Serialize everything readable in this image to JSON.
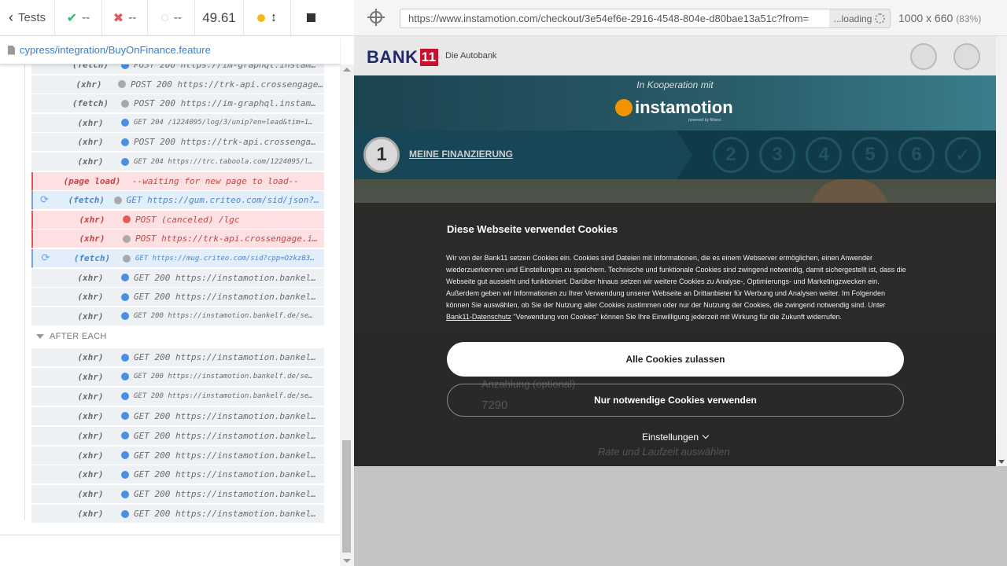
{
  "reporter": {
    "tests_label": "Tests",
    "passed": "--",
    "failed": "--",
    "pending": "--",
    "duration": "49.61",
    "spec_path": "cypress/integration/BuyOnFinance.feature",
    "hook_label": "AFTER EACH",
    "commands": [
      {
        "kind": "(fetch)",
        "dot": "blue",
        "text": "POST 200 https://im-graphql.instam…",
        "state": "normal",
        "small": false
      },
      {
        "kind": "(xhr)",
        "dot": "grey",
        "text": "POST 200 https://trk-api.crossengage.i…",
        "state": "normal",
        "small": false
      },
      {
        "kind": "(fetch)",
        "dot": "grey",
        "text": "POST 200 https://im-graphql.instam…",
        "state": "normal",
        "small": false
      },
      {
        "kind": "(xhr)",
        "dot": "blue",
        "text": "GET 204 /1224095/log/3/unip?en=lead&tim=1…",
        "state": "normal",
        "small": true
      },
      {
        "kind": "(xhr)",
        "dot": "blue",
        "text": "POST 200 https://trk-api.crossenga…",
        "state": "normal",
        "small": false
      },
      {
        "kind": "(xhr)",
        "dot": "blue",
        "text": "GET 204 https://trc.taboola.com/1224095/l…",
        "state": "normal",
        "small": true
      },
      {
        "kind": "(page load)",
        "dot": "",
        "text": "--waiting for new page to load--",
        "state": "failed",
        "small": false
      },
      {
        "kind": "(fetch)",
        "dot": "grey",
        "text": "GET https://gum.criteo.com/sid/json?origi…",
        "state": "pending",
        "small": false
      },
      {
        "kind": "(xhr)",
        "dot": "red",
        "text": "POST (canceled) /lgc",
        "state": "failed",
        "small": false
      },
      {
        "kind": "(xhr)",
        "dot": "grey",
        "text": "POST https://trk-api.crossengage.i…",
        "state": "failed",
        "small": false
      },
      {
        "kind": "(fetch)",
        "dot": "grey",
        "text": "GET https://mug.criteo.com/sid?cpp=OzkzB3…",
        "state": "pending",
        "small": true
      },
      {
        "kind": "(xhr)",
        "dot": "blue",
        "text": "GET 200 https://instamotion.bankel…",
        "state": "normal",
        "small": false
      },
      {
        "kind": "(xhr)",
        "dot": "blue",
        "text": "GET 200 https://instamotion.bankel…",
        "state": "normal",
        "small": false
      },
      {
        "kind": "(xhr)",
        "dot": "blue",
        "text": "GET 200 https://instamotion.bankelf.de/se…",
        "state": "normal",
        "small": true
      }
    ],
    "after_each": [
      {
        "kind": "(xhr)",
        "dot": "blue",
        "text": "GET 200 https://instamotion.bankel…",
        "small": false
      },
      {
        "kind": "(xhr)",
        "dot": "blue",
        "text": "GET 200 https://instamotion.bankelf.de/se…",
        "small": true
      },
      {
        "kind": "(xhr)",
        "dot": "blue",
        "text": "GET 200 https://instamotion.bankelf.de/se…",
        "small": true
      },
      {
        "kind": "(xhr)",
        "dot": "blue",
        "text": "GET 200 https://instamotion.bankel…",
        "small": false
      },
      {
        "kind": "(xhr)",
        "dot": "blue",
        "text": "GET 200 https://instamotion.bankel…",
        "small": false
      },
      {
        "kind": "(xhr)",
        "dot": "blue",
        "text": "GET 200 https://instamotion.bankel…",
        "small": false
      },
      {
        "kind": "(xhr)",
        "dot": "blue",
        "text": "GET 200 https://instamotion.bankel…",
        "small": false
      },
      {
        "kind": "(xhr)",
        "dot": "blue",
        "text": "GET 200 https://instamotion.bankel…",
        "small": false
      },
      {
        "kind": "(xhr)",
        "dot": "blue",
        "text": "GET 200 https://instamotion.bankel…",
        "small": false
      }
    ]
  },
  "aut": {
    "url": "https://www.instamotion.com/checkout/3e54ef6e-2916-4548-804e-d80bae13a51c?from=",
    "loading_label": "...loading",
    "viewport": "1000 x 660",
    "scale": "(83%)"
  },
  "site": {
    "brand": "BANK",
    "brand_num": "11",
    "tagline": "Die Autobank",
    "koop_text": "In Kooperation mit",
    "partner": "instamotion",
    "partner_sub": "powered by Allianz",
    "step_active_num": "1",
    "step_label": "MEINE FINANZIERUNG",
    "steps": [
      "2",
      "3",
      "4",
      "5",
      "6",
      "✓"
    ],
    "ghost_label": "Anzahlung (optional)",
    "ghost_value": "7290",
    "ghost_bottom": "Rate und Laufzeit auswählen"
  },
  "cookie": {
    "title": "Diese Webseite verwendet Cookies",
    "text_before": "Wir von der Bank11 setzen Cookies ein. Cookies sind Dateien mit Informationen, die es einem Webserver ermöglichen, einen Anwender wiederzuerkennen und Einstellungen zu speichern. Technische und funktionale Cookies sind zwingend notwendig, damit sichergestellt ist, dass die Webseite gut aussieht und funktioniert. Darüber hinaus setzen wir weitere Cookies zu Analyse-, Optimierungs- und Marketingzwecken ein. Außerdem geben wir Informationen zu Ihrer Verwendung unserer Webseite an Drittanbieter für Werbung und Analysen weiter. Im Folgenden können Sie auswählen, ob Sie der Nutzung aller Cookies zustimmen oder nur der Nutzung der Cookies, die zwingend notwendig sind. Unter ",
    "link": "Bank11-Datenschutz",
    "text_after": " \"Verwendung von Cookies\" können Sie Ihre Einwilligung jederzeit mit Wirkung für die Zukunft widerrufen.",
    "accept_all": "Alle Cookies zulassen",
    "only_needed": "Nur notwendige Cookies verwenden",
    "settings": "Einstellungen"
  }
}
